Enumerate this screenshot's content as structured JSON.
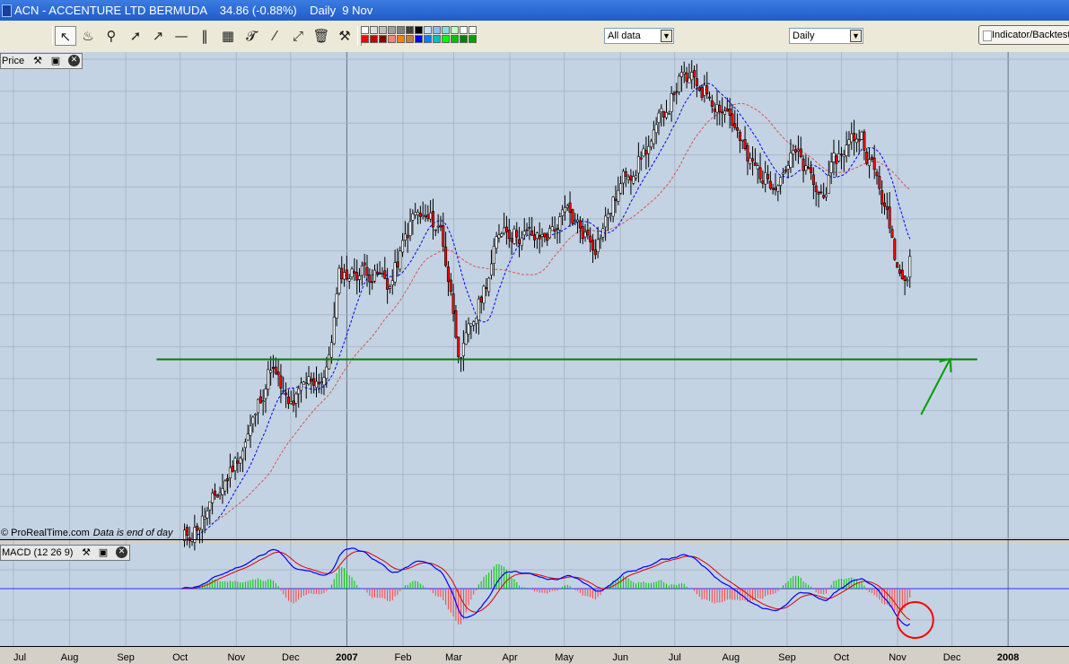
{
  "window": {
    "title": "ACN - ACCENTURE LTD BERMUDA    34.86 (-0.88%)    Daily  9 Nov"
  },
  "toolbar": {
    "tools": [
      "pointer-icon",
      "alarm-bell-icon",
      "zoom-icon",
      "line-segment-icon",
      "trend-line-icon",
      "horizontal-line-icon",
      "vertical-line-icon",
      "fibonacci-icon",
      "text-tool-icon",
      "parallel-channel-icon",
      "regression-channel-icon",
      "trash-icon",
      "drawing-properties-icon"
    ],
    "palette_colors": [
      "#ffffff",
      "#e0e0e0",
      "#c0c0c0",
      "#a0a0a0",
      "#808080",
      "#404040",
      "#000000",
      "#c0e0ff",
      "#80c0ff",
      "#80e0e0",
      "#c0ffc0",
      "#ffffff",
      "#ffffff",
      "#ff0000",
      "#c00000",
      "#800000",
      "#ff8080",
      "#ff8000",
      "#c08040",
      "#0000ff",
      "#0080ff",
      "#00c0c0",
      "#00ff00",
      "#00c000",
      "#008000",
      "#00a000"
    ],
    "data_range": "All data",
    "period": "Daily",
    "indicator_button": "Indicator/Backtest"
  },
  "price_panel": {
    "tab_label": "Price",
    "credit": "© ProRealTime.com",
    "credit_note": "Data is end of day"
  },
  "macd_panel": {
    "tab_label": "MACD (12 26 9)"
  },
  "colors": {
    "background": "#c3d3e3",
    "grid": "#a9b8c9",
    "candle_up": "#ffffff",
    "candle_down": "#ff0000",
    "short_ma": "#0000ff",
    "long_ma": "#e05050",
    "support_line": "#008000",
    "arrow": "#00a000",
    "macd_line": "#0000ff",
    "signal_line": "#e00000",
    "histogram_pos": "#00c000",
    "histogram_neg": "#ff4040",
    "circle": "#ff0000"
  },
  "chart_data": [
    {
      "type": "candlestick",
      "series": [
        {
          "name": "price"
        },
        {
          "name": "short_ma"
        },
        {
          "name": "long_ma"
        }
      ],
      "x_labels": [
        "Jul",
        "Aug",
        "Sep",
        "Oct",
        "Nov",
        "Dec",
        "2007",
        "Feb",
        "Mar",
        "Apr",
        "May",
        "Jun",
        "Jul",
        "Aug",
        "Sep",
        "Oct",
        "Nov",
        "Dec",
        "2008"
      ],
      "x_label_bold": [
        "2007",
        "2008"
      ],
      "anchors": [
        {
          "date": "2006-10-02",
          "close": 28.3
        },
        {
          "date": "2006-10-20",
          "close": 29.2
        },
        {
          "date": "2006-11-10",
          "close": 31.0
        },
        {
          "date": "2006-11-20",
          "close": 32.4
        },
        {
          "date": "2006-11-30",
          "close": 31.3
        },
        {
          "date": "2006-12-12",
          "close": 32.0
        },
        {
          "date": "2006-12-21",
          "close": 32.2
        },
        {
          "date": "2006-12-28",
          "close": 34.4
        },
        {
          "date": "2007-01-12",
          "close": 34.6
        },
        {
          "date": "2007-01-25",
          "close": 34.2
        },
        {
          "date": "2007-02-07",
          "close": 35.8
        },
        {
          "date": "2007-02-22",
          "close": 35.5
        },
        {
          "date": "2007-03-05",
          "close": 32.5
        },
        {
          "date": "2007-03-14",
          "close": 33.6
        },
        {
          "date": "2007-03-28",
          "close": 35.6
        },
        {
          "date": "2007-04-17",
          "close": 35.2
        },
        {
          "date": "2007-05-02",
          "close": 35.8
        },
        {
          "date": "2007-05-18",
          "close": 35.2
        },
        {
          "date": "2007-06-05",
          "close": 36.8
        },
        {
          "date": "2007-06-20",
          "close": 37.6
        },
        {
          "date": "2007-07-03",
          "close": 38.9
        },
        {
          "date": "2007-07-18",
          "close": 38.7
        },
        {
          "date": "2007-07-31",
          "close": 38.2
        },
        {
          "date": "2007-08-10",
          "close": 37.0
        },
        {
          "date": "2007-08-22",
          "close": 36.6
        },
        {
          "date": "2007-09-05",
          "close": 37.2
        },
        {
          "date": "2007-09-19",
          "close": 36.2
        },
        {
          "date": "2007-10-03",
          "close": 37.4
        },
        {
          "date": "2007-10-12",
          "close": 37.7
        },
        {
          "date": "2007-10-23",
          "close": 36.3
        },
        {
          "date": "2007-11-02",
          "close": 34.5
        },
        {
          "date": "2007-11-09",
          "close": 34.86
        }
      ],
      "annotations": {
        "support_line": {
          "start": "2006-09-18",
          "end": "2007-12-15",
          "value": 32.5
        },
        "arrow": {
          "start": "2007-11-14",
          "end": "2007-11-30"
        }
      },
      "ylim": [
        28.4,
        39.5
      ],
      "grid": true
    },
    {
      "type": "line",
      "series": [
        {
          "name": "macd_line"
        },
        {
          "name": "signal_line"
        },
        {
          "name": "histogram"
        }
      ],
      "annotation": "circle at recent bearish MACD low",
      "ylim": [
        -0.5,
        0.5
      ],
      "grid": true
    }
  ]
}
